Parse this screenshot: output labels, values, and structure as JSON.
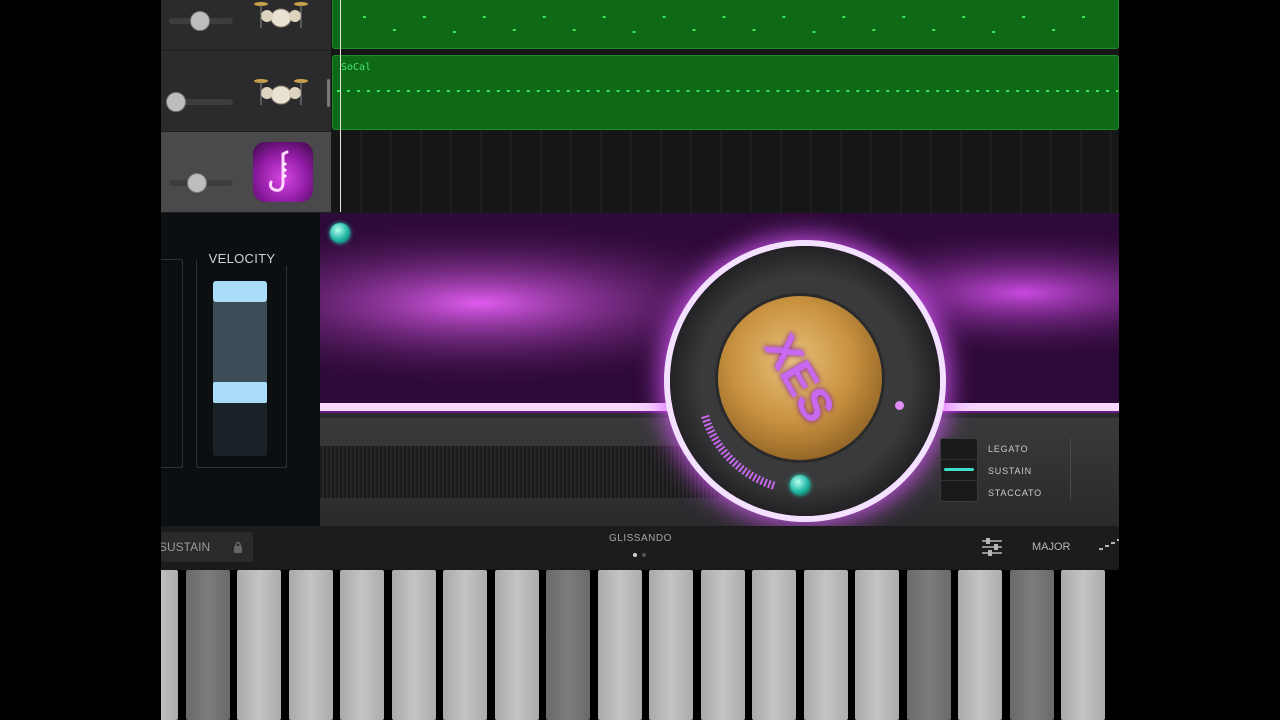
{
  "tracks": [
    {
      "name": "drums-track-1",
      "icon": "drum-kit-icon",
      "volume": 0.4
    },
    {
      "name": "drums-track-2",
      "icon": "drum-kit-icon",
      "volume": 0.2
    },
    {
      "name": "saxophone-track",
      "icon": "neon-saxophone-icon",
      "volume": 0.38,
      "selected": true
    }
  ],
  "regions": [
    {
      "label": ""
    },
    {
      "label": "SoCal"
    }
  ],
  "velocity": {
    "title": "VELOCITY",
    "top_value": 1.0,
    "bottom_value": 0.42
  },
  "instrument": {
    "logo_text": "XES"
  },
  "articulation": {
    "options": [
      "LEGATO",
      "SUSTAIN",
      "STACCATO"
    ],
    "selected": "SUSTAIN"
  },
  "control_bar": {
    "sustain_label": "SUSTAIN",
    "mode_label": "GLISSANDO",
    "scale_label": "MAJOR",
    "page_count": 2,
    "page_active": 1
  },
  "keyboard": {
    "key_shades": [
      "light",
      "dark",
      "light",
      "light",
      "light",
      "light",
      "light",
      "light",
      "dark",
      "light",
      "light",
      "light",
      "light",
      "light",
      "light",
      "dark",
      "light",
      "dark",
      "light"
    ]
  },
  "colors": {
    "region_green": "#0e6a17",
    "note_green": "#3ee65a",
    "accent_purple": "#c768ee",
    "gem_teal": "#1fb7a3"
  }
}
